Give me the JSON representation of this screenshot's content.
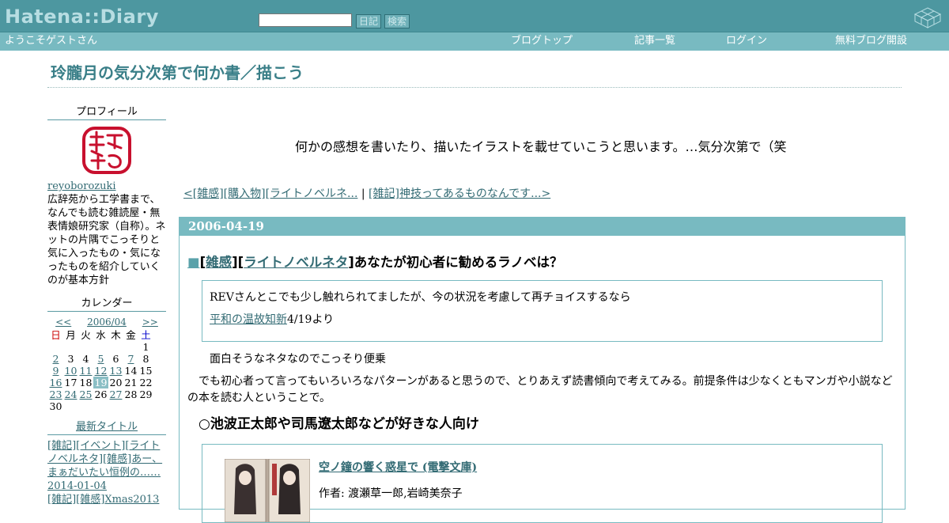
{
  "header": {
    "logo": "Hatena::Diary",
    "search_placeholder": "",
    "diary_button": "日記",
    "search_button": "検索",
    "welcome": "ようこそゲストさん",
    "nav": [
      "ブログトップ",
      "記事一覧",
      "ログイン",
      "無料ブログ開設"
    ]
  },
  "diary_title": "玲朧月の気分次第で何か書／描こう",
  "description": "何かの感想を書いたり、描いたイラストを載せていこうと思います。…気分次第で（笑",
  "pager": {
    "prev": "<[雑感][購入物][ライトノベルネ...",
    "separator": " | ",
    "next": "[雑記]神技ってあるものなんです...>"
  },
  "sidebar": {
    "profile_heading": "プロフィール",
    "user_id": "reyoborozuki",
    "profile_text": "広辞苑から工学書まで、なんでも読む雑読屋・無表情娘研究家（自称）。ネットの片隅でこっそりと気に入ったもの・気になったものを紹介していくのが基本方針",
    "calendar_heading": "カレンダー",
    "calendar_prev": "<<",
    "calendar_month": "2006/04",
    "calendar_next": ">>",
    "weekdays": [
      "日",
      "月",
      "火",
      "水",
      "木",
      "金",
      "土"
    ],
    "weeks": [
      [
        "",
        "",
        "",
        "",
        "",
        "",
        "1"
      ],
      [
        "2",
        "3",
        "4",
        "5",
        "6",
        "7",
        "8"
      ],
      [
        "9",
        "10",
        "11",
        "12",
        "13",
        "14",
        "15"
      ],
      [
        "16",
        "17",
        "18",
        "19",
        "20",
        "21",
        "22"
      ],
      [
        "23",
        "24",
        "25",
        "26",
        "27",
        "28",
        "29"
      ],
      [
        "30",
        "",
        "",
        "",
        "",
        "",
        ""
      ]
    ],
    "linked_days": [
      "2",
      "5",
      "7",
      "9",
      "10",
      "11",
      "12",
      "13",
      "16",
      "23",
      "24",
      "25",
      "27"
    ],
    "today": "19",
    "latest_heading": "最新タイトル",
    "latest_items": [
      {
        "links": [
          "[雑記]",
          "[イベント]",
          "[ライトノベルネタ]",
          "[雑感]",
          "あー、まぁだいたい恒例の……"
        ],
        "date": "2014-01-04"
      },
      {
        "links": [
          "[雑記]",
          "[雑感]",
          "Xmas2013"
        ],
        "date": ""
      }
    ]
  },
  "entry": {
    "date": "2006-04-19",
    "title_marker": "■",
    "title_cat1": "雑感",
    "title_cat2": "ライトノベルネタ",
    "title_text": "あなたが初心者に勧めるラノベは？",
    "quote_line1": "REVさんとこでも少し触れられてましたが、今の状況を考慮して再チョイスするなら",
    "quote_link": "平和の温故知新",
    "quote_suffix": "4/19より",
    "para1": "面白そうなネタなのでこっそり便乗",
    "para2": "でも初心者って言ってもいろいろなパターンがあると思うので、とりあえず読書傾向で考えてみる。前提条件は少なくともマンガや小説などの本を読む人ということで。",
    "subheading": "○池波正太郎や司馬遼太郎などが好きな人向け",
    "book_title": "空ノ鐘の響く惑星で (電撃文庫)",
    "book_author": "作者: 渡瀬草一郎,岩崎美奈子"
  },
  "colors": {
    "topbar": "#4d97a0",
    "navbar": "#78bac1",
    "accent": "#336b74",
    "title": "#3a7f88"
  }
}
